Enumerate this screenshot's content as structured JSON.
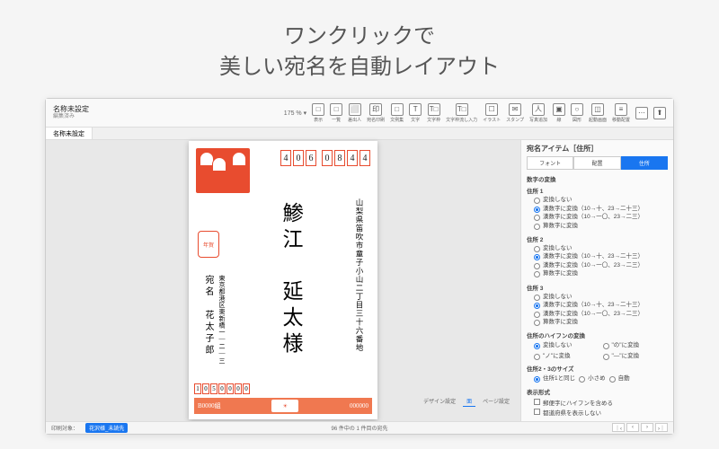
{
  "headline": {
    "line1": "ワンクリックで",
    "line2": "美しい宛名を自動レイアウト"
  },
  "toolbar": {
    "title": "名称未設定",
    "subtitle": "編集済み",
    "zoom": "175 % ▾",
    "tools": [
      {
        "icon": "□",
        "label": "表示"
      },
      {
        "icon": "□",
        "label": "一覧"
      },
      {
        "icon": "⬜",
        "label": "差出人"
      },
      {
        "icon": "印",
        "label": "宛名印刷"
      },
      {
        "icon": "□",
        "label": "文例集"
      },
      {
        "icon": "T",
        "label": "文字"
      },
      {
        "icon": "T□",
        "label": "文字枠"
      },
      {
        "icon": "T□",
        "label": "文字枠流し入力"
      },
      {
        "icon": "☐",
        "label": "イラスト"
      },
      {
        "icon": "✉",
        "label": "スタンプ"
      },
      {
        "icon": "人",
        "label": "写真追加"
      },
      {
        "icon": "▣",
        "label": "線"
      },
      {
        "icon": "○",
        "label": "図形"
      },
      {
        "icon": "◫",
        "label": "起動画面"
      },
      {
        "icon": "≡",
        "label": "移動配置"
      },
      {
        "icon": "⋯",
        "label": ""
      },
      {
        "icon": "⬆",
        "label": ""
      }
    ]
  },
  "tabs": {
    "tab1": "名称未設定"
  },
  "postcard": {
    "zip_recipient": [
      "4",
      "0",
      "6",
      "0",
      "8",
      "4",
      "4"
    ],
    "address_recipient": "山梨県笛吹市童子小山二丁目三十六番地",
    "name_recipient": "鯵江　延太様",
    "sender_addr": "東京都港区東新橋一―二―三",
    "sender_name": "宛名　花太子郎",
    "stamp_text": "年賀",
    "zip_sender": [
      "1",
      "0",
      "5",
      "0",
      "0",
      "0",
      "0"
    ],
    "band_left": "B0000組",
    "band_mid": "☀",
    "band_right": "000000"
  },
  "sidebar": {
    "title": "宛名アイテム［住所］",
    "tabs": [
      "フォント",
      "配置",
      "住所"
    ],
    "digit_section": "数字の変換",
    "addr_labels": [
      "住所 1",
      "住所 2",
      "住所 3"
    ],
    "opts": {
      "none": "変換しない",
      "kan1": "漢数字に変換（10→十、23→二十三）",
      "kan2": "漢数字に変換（10→一〇、23→二三）",
      "san": "算数字に変換"
    },
    "hyphen_section": "住所のハイフンの変換",
    "hyphen_opts": [
      "変換しない",
      "\"の\"に変換",
      "\"ノ\"に変換",
      "\"—\"に変換"
    ],
    "size_section": "住所2・3のサイズ",
    "size_opts": [
      "住所1と同じ",
      "小さめ",
      "自動"
    ],
    "disp_section": "表示形式",
    "disp_opts": [
      "郵便字にハイフンを含める",
      "都道府県を表示しない"
    ]
  },
  "status": {
    "left_label": "印刷対象：",
    "left_value": "花沢様_未読先",
    "center": "96 件中の 1 件目の宛先",
    "footer_tabs": [
      "デザイン設定",
      "面",
      "ページ設定"
    ],
    "nav": [
      "｜‹",
      "‹",
      "›",
      "›｜"
    ]
  }
}
